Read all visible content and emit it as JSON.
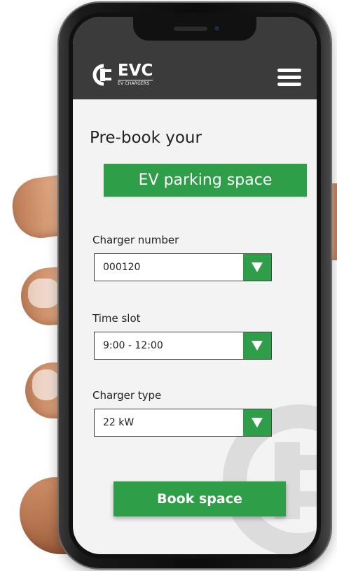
{
  "brand": {
    "logo_word": "EVC",
    "logo_sub": "EV CHARGERS",
    "logo_icon": "plug-logo-icon"
  },
  "header": {
    "menu_icon": "hamburger-menu-icon"
  },
  "headline": {
    "line1": "Pre-book your",
    "line2": "EV parking space"
  },
  "form": {
    "charger_number": {
      "label": "Charger number",
      "value": "000120"
    },
    "time_slot": {
      "label": "Time slot",
      "value": "9:00 - 12:00"
    },
    "charger_type": {
      "label": "Charger type",
      "value": "22 kW"
    },
    "submit_label": "Book space"
  },
  "colors": {
    "accent": "#2e9e48",
    "header": "#3b3b3b",
    "screen_bg": "#f3f3f3",
    "text": "#222222"
  }
}
